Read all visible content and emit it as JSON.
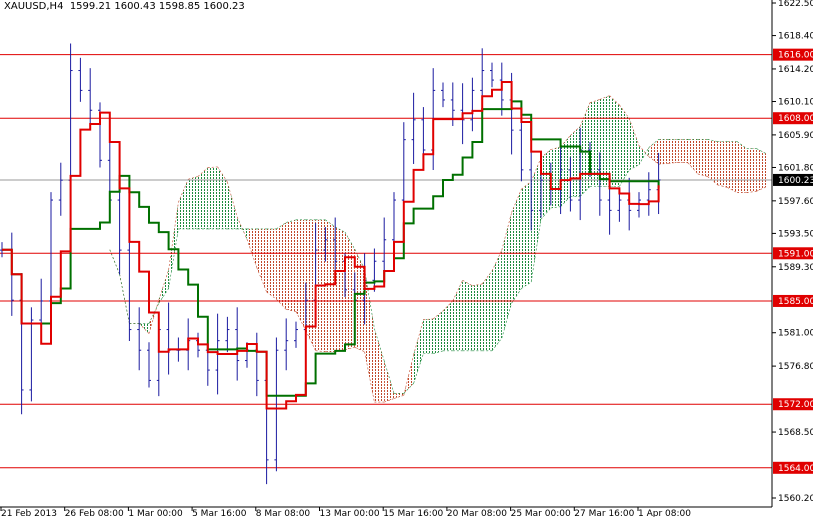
{
  "header": {
    "symbol": "XAUUSD,H4",
    "ohlc": "1599.21 1600.43 1598.85 1600.23"
  },
  "colors": {
    "up_bar": "#1a1aa0",
    "tenkan": "#e00000",
    "kijun": "#007000",
    "cloud_bull": "#1c8a3c",
    "cloud_bear": "#c0482a",
    "level": "#e00000",
    "level_label_bg": "#e00000",
    "current_label_bg": "#000000"
  },
  "chart_data": {
    "type": "candlestick",
    "title": "XAUUSD,H4",
    "ylim": [
      1560.2,
      1622.5
    ],
    "y_ticks": [
      "1622.50",
      "1618.40",
      "1614.20",
      "1610.10",
      "1605.90",
      "1601.80",
      "1597.60",
      "1593.50",
      "1589.30",
      "1581.00",
      "1576.80",
      "1568.50",
      "1560.20"
    ],
    "x_ticks": [
      "21 Feb 2013",
      "26 Feb 08:00",
      "1 Mar 00:00",
      "5 Mar 16:00",
      "8 Mar 08:00",
      "13 Mar 00:00",
      "15 Mar 16:00",
      "20 Mar 08:00",
      "25 Mar 00:00",
      "27 Mar 16:00",
      "1 Apr 08:00"
    ],
    "closes": [
      1591.4,
      1585.1,
      1573.8,
      1582.6,
      1585.0,
      1597.7,
      1600.2,
      1614.0,
      1611.5,
      1609.0,
      1602.7,
      1597.7,
      1591.4,
      1581.4,
      1578.8,
      1575.0,
      1581.4,
      1578.8,
      1578.8,
      1580.0,
      1578.8,
      1576.3,
      1580.0,
      1581.4,
      1577.5,
      1578.8,
      1575.0,
      1565.0,
      1578.8,
      1580.0,
      1581.4,
      1585.1,
      1591.4,
      1592.7,
      1590.0,
      1586.4,
      1585.1,
      1587.6,
      1590.0,
      1592.7,
      1597.7,
      1605.3,
      1607.8,
      1604.0,
      1611.5,
      1610.3,
      1609.0,
      1607.8,
      1611.5,
      1614.0,
      1612.8,
      1610.3,
      1606.5,
      1601.5,
      1596.4,
      1600.2,
      1599.0,
      1601.5,
      1597.7,
      1604.0,
      1601.5,
      1597.7,
      1596.4,
      1597.7,
      1596.4,
      1597.7,
      1599.0,
      1600.23
    ],
    "indicator": "Ichimoku Kinko Hyo",
    "levels": [
      {
        "value": 1616.0,
        "label": "1616.00"
      },
      {
        "value": 1608.0,
        "label": "1608.00"
      },
      {
        "value": 1591.0,
        "label": "1591.00"
      },
      {
        "value": 1585.0,
        "label": "1585.00"
      },
      {
        "value": 1572.0,
        "label": "1572.00"
      },
      {
        "value": 1564.0,
        "label": "1564.00"
      }
    ],
    "current_price": {
      "value": 1600.23,
      "label": "1600.23"
    }
  }
}
